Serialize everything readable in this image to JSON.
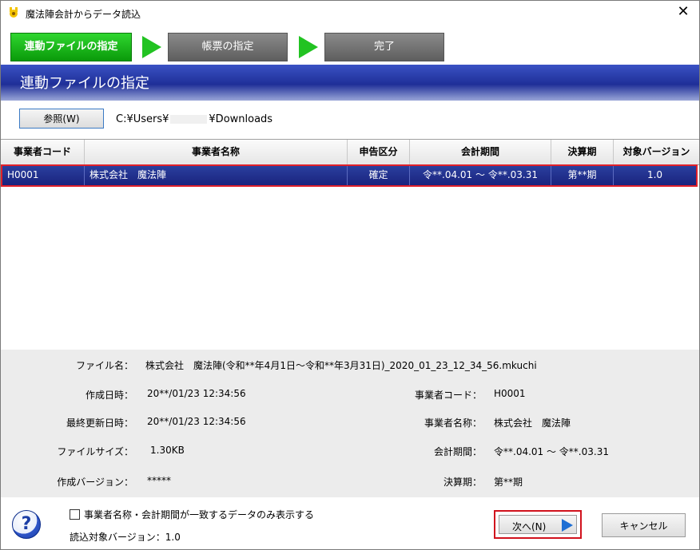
{
  "window": {
    "title": "魔法陣会計からデータ読込",
    "close_glyph": "✕"
  },
  "steps": [
    {
      "label": "連動ファイルの指定",
      "state": "active"
    },
    {
      "label": "帳票の指定",
      "state": "inactive"
    },
    {
      "label": "完了",
      "state": "inactive"
    }
  ],
  "banner": {
    "title": "連動ファイルの指定"
  },
  "path": {
    "button_label": "参照(W)",
    "prefix": "C:¥Users¥",
    "suffix": "¥Downloads"
  },
  "table": {
    "headers": [
      "事業者コード",
      "事業者名称",
      "申告区分",
      "会計期間",
      "決算期",
      "対象バージョン"
    ],
    "rows": [
      [
        "H0001",
        "株式会社　魔法陣",
        "確定",
        "令**.04.01 ～ 令**.03.31",
        "第**期",
        "1.0"
      ]
    ]
  },
  "details": {
    "file_name_label": "ファイル名：",
    "file_name": "株式会社　魔法陣(令和**年4月1日～令和**年3月31日)_2020_01_23_12_34_56.mkuchi",
    "created_label": "作成日時：",
    "created": "20**/01/23 12:34:56",
    "updated_label": "最終更新日時：",
    "updated": "20**/01/23 12:34:56",
    "size_label": "ファイルサイズ：",
    "size": "1.30KB",
    "version_label": "作成バージョン：",
    "version": "*****",
    "code_label": "事業者コード：",
    "code": "H0001",
    "name_label": "事業者名称：",
    "name": "株式会社　魔法陣",
    "period_label": "会計期間：",
    "period": "令**.04.01 ～ 令**.03.31",
    "fiscal_label": "決算期：",
    "fiscal": "第**期"
  },
  "footer": {
    "help_glyph": "?",
    "checkbox_label": "事業者名称・会計期間が一致するデータのみ表示する",
    "read_version_label": "読込対象バージョン：",
    "read_version": "1.0",
    "next_label": "次へ(N)",
    "cancel_label": "キャンセル"
  },
  "colors": {
    "accent_green": "#1cb71c",
    "banner_blue": "#1f2f98",
    "selection_blue": "#1a237e",
    "highlight_red": "#d1121d"
  }
}
